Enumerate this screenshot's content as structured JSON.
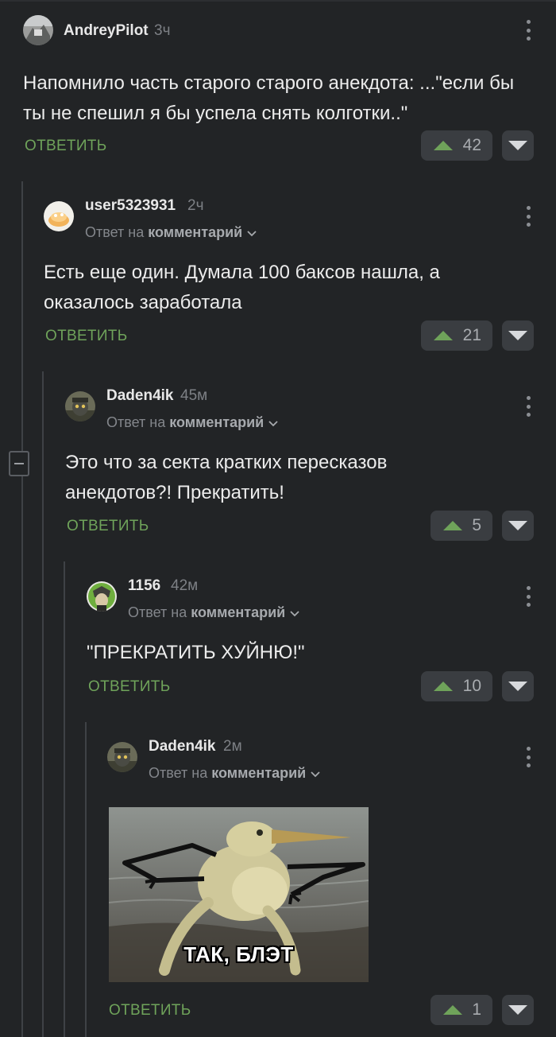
{
  "comments": [
    {
      "username": "AndreyPilot",
      "time": "3ч",
      "text": "Напомнило часть старого старого анекдота: ...\"если бы ты не спешил я бы успела снять колготки..\"",
      "reply_label": "ОТВЕТИТЬ",
      "votes": "42"
    },
    {
      "username": "user5323931",
      "time": "2ч",
      "reply_to_prefix": "Ответ на",
      "reply_to_target": "комментарий",
      "text": "Есть еще один. Думала 100 баксов нашла, а оказалось заработала",
      "reply_label": "ОТВЕТИТЬ",
      "votes": "21"
    },
    {
      "username": "Daden4ik",
      "time": "45м",
      "reply_to_prefix": "Ответ на",
      "reply_to_target": "комментарий",
      "text": "Это что за секта кратких пересказов анекдотов?! Прекратить!",
      "reply_label": "ОТВЕТИТЬ",
      "votes": "5"
    },
    {
      "username": "1156",
      "time": "42м",
      "reply_to_prefix": "Ответ на",
      "reply_to_target": "комментарий",
      "text": "\"ПРЕКРАТИТЬ ХУЙНЮ!\"",
      "reply_label": "ОТВЕТИТЬ",
      "votes": "10"
    },
    {
      "username": "Daden4ik",
      "time": "2м",
      "reply_to_prefix": "Ответ на",
      "reply_to_target": "комментарий",
      "image_caption": "ТАК, БЛЭТ",
      "reply_label": "ОТВЕТИТЬ",
      "votes": "1"
    }
  ],
  "colors": {
    "background": "#222426",
    "accent_green": "#6fa35a",
    "vote_box": "#3a3d41"
  },
  "icons": [
    "avatar",
    "kebab-menu-icon",
    "chevron-down-icon",
    "upvote-icon",
    "downvote-icon",
    "collapse-icon"
  ]
}
